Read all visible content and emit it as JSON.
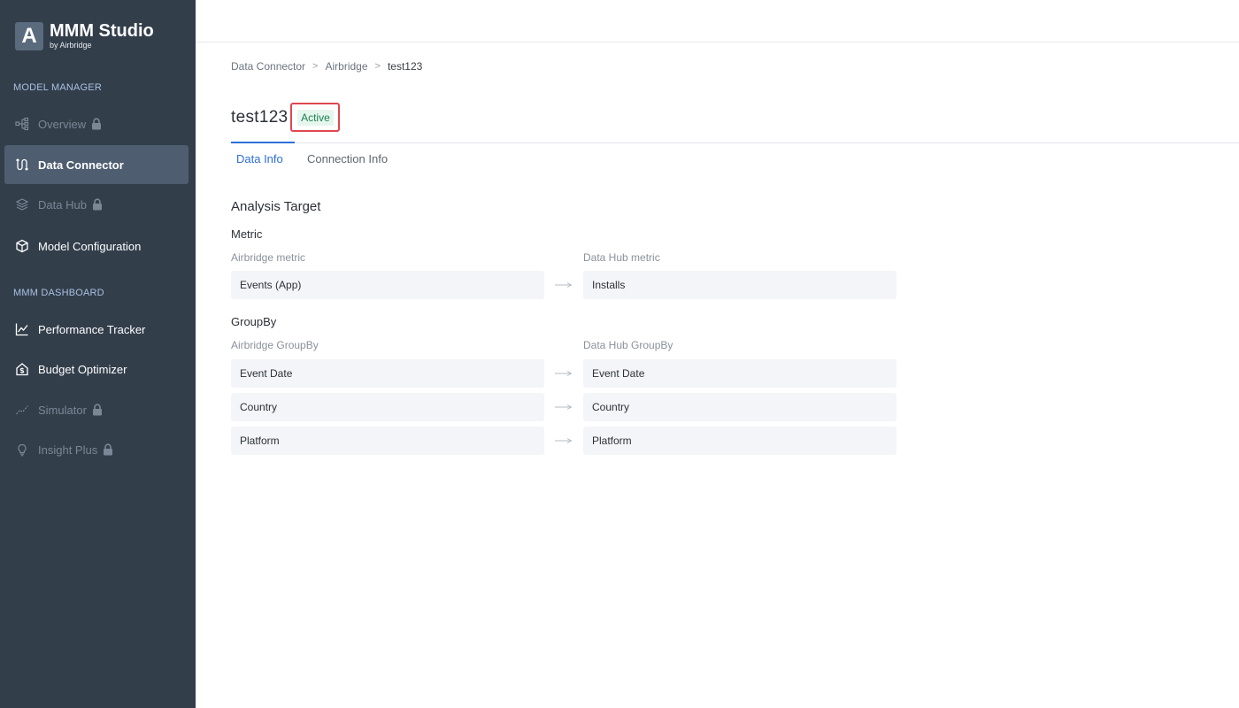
{
  "brand": {
    "logo_letter": "A",
    "title": "MMM Studio",
    "subtitle": "by Airbridge"
  },
  "sidebar": {
    "sections": [
      {
        "label": "MODEL MANAGER"
      },
      {
        "label": "MMM DASHBOARD"
      }
    ],
    "items": [
      {
        "label": "Overview",
        "icon": "hierarchy-icon",
        "locked": true
      },
      {
        "label": "Data Connector",
        "icon": "connector-icon",
        "active": true
      },
      {
        "label": "Data Hub",
        "icon": "layers-icon",
        "locked": true
      },
      {
        "label": "Model Configuration",
        "icon": "cube-icon"
      },
      {
        "label": "Performance Tracker",
        "icon": "line-chart-icon"
      },
      {
        "label": "Budget Optimizer",
        "icon": "house-dollar-icon"
      },
      {
        "label": "Simulator",
        "icon": "trend-icon",
        "locked": true
      },
      {
        "label": "Insight Plus",
        "icon": "bulb-icon",
        "locked": true
      }
    ]
  },
  "breadcrumb": {
    "items": [
      "Data Connector",
      "Airbridge",
      "test123"
    ],
    "separator": ">"
  },
  "page": {
    "title": "test123",
    "status": "Active"
  },
  "tabs": [
    {
      "label": "Data Info",
      "active": true
    },
    {
      "label": "Connection Info"
    }
  ],
  "analysis": {
    "heading": "Analysis Target",
    "metric": {
      "heading": "Metric",
      "left_label": "Airbridge metric",
      "right_label": "Data Hub metric",
      "rows": [
        {
          "left": "Events (App)",
          "right": "Installs"
        }
      ]
    },
    "groupby": {
      "heading": "GroupBy",
      "left_label": "Airbridge GroupBy",
      "right_label": "Data Hub GroupBy",
      "rows": [
        {
          "left": "Event Date",
          "right": "Event Date"
        },
        {
          "left": "Country",
          "right": "Country"
        },
        {
          "left": "Platform",
          "right": "Platform"
        }
      ]
    }
  },
  "colors": {
    "sidebar_bg": "#333e4b",
    "sidebar_active": "#4e5d70",
    "accent_blue": "#2d6fd6",
    "status_green": "#1e7f4f",
    "highlight_red": "#e0474f"
  }
}
